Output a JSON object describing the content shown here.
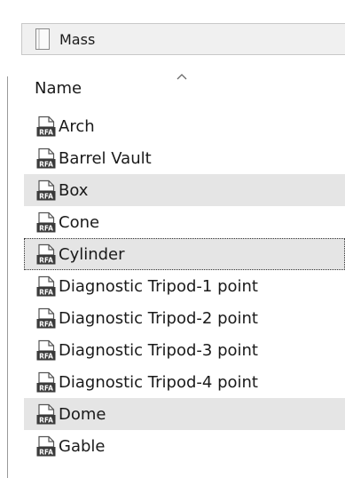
{
  "path_bar": {
    "folder_name": "Mass"
  },
  "column_header": {
    "name_label": "Name",
    "sort_glyph": "^"
  },
  "icons": {
    "file_icon_text": "RFA"
  },
  "files": [
    {
      "label": "Arch",
      "state": "normal"
    },
    {
      "label": "Barrel Vault",
      "state": "normal"
    },
    {
      "label": "Box",
      "state": "selected"
    },
    {
      "label": "Cone",
      "state": "normal"
    },
    {
      "label": "Cylinder",
      "state": "focused"
    },
    {
      "label": "Diagnostic Tripod-1 point",
      "state": "normal"
    },
    {
      "label": "Diagnostic Tripod-2 point",
      "state": "normal"
    },
    {
      "label": "Diagnostic Tripod-3 point",
      "state": "normal"
    },
    {
      "label": "Diagnostic Tripod-4 point",
      "state": "normal"
    },
    {
      "label": "Dome",
      "state": "selected"
    },
    {
      "label": "Gable",
      "state": "normal"
    }
  ]
}
